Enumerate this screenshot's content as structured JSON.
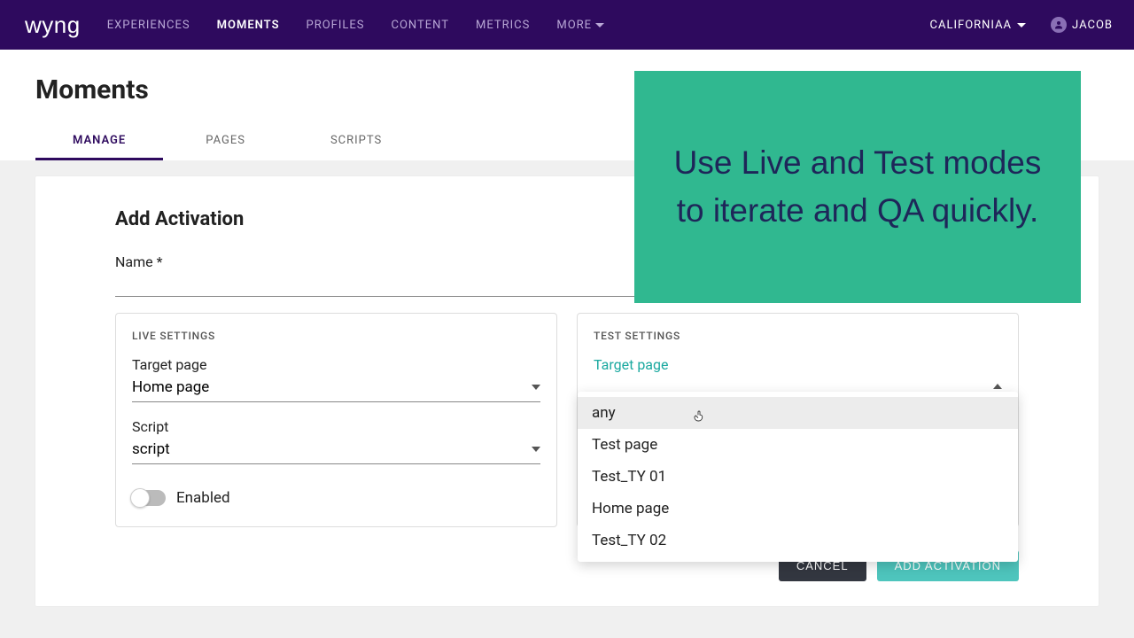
{
  "nav": {
    "logo": "wyng",
    "items": [
      "EXPERIENCES",
      "MOMENTS",
      "PROFILES",
      "CONTENT",
      "METRICS",
      "MORE"
    ],
    "active_index": 1,
    "account": "CALIFORNIAA",
    "user": "JACOB"
  },
  "page": {
    "title": "Moments",
    "subtabs": [
      "MANAGE",
      "PAGES",
      "SCRIPTS"
    ],
    "active_subtab": 0
  },
  "banner": {
    "text": "Use Live and Test modes to iterate and QA quickly."
  },
  "form": {
    "section_title": "Add Activation",
    "name_label": "Name *",
    "name_value": "",
    "live": {
      "panel_title": "LIVE SETTINGS",
      "target_label": "Target page",
      "target_value": "Home page",
      "script_label": "Script",
      "script_value": "script",
      "toggle_label": "Enabled",
      "toggle_on": false
    },
    "test": {
      "panel_title": "TEST SETTINGS",
      "target_label": "Target page",
      "target_value": "",
      "dropdown_open": true,
      "options": [
        "any",
        "Test page",
        "Test_TY 01",
        "Home page",
        "Test_TY 02"
      ],
      "highlight_index": 0
    },
    "actions": {
      "cancel": "CANCEL",
      "submit": "ADD ACTIVATION"
    }
  }
}
